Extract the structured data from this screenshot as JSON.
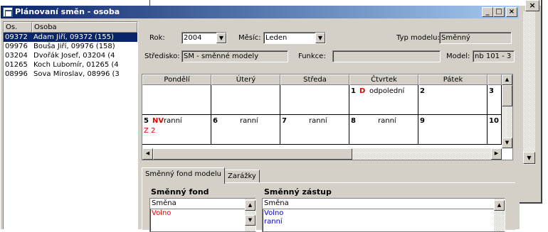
{
  "background": {
    "chars": [
      "ě",
      "í"
    ]
  },
  "window": {
    "title": "Plánovaní směn - osoba",
    "controls": {
      "minimize": "_",
      "maximize": "□",
      "close": "×"
    }
  },
  "employees": {
    "columns": [
      "Os. číslo",
      "Osoba"
    ],
    "rows": [
      {
        "id": "09372",
        "name": "Adam Jiří, 09372 (155)",
        "selected": true
      },
      {
        "id": "09976",
        "name": "Bouša Jiří, 09976 (158)",
        "selected": false
      },
      {
        "id": "03204",
        "name": "Dvořák Josef, 03204 (4",
        "selected": false
      },
      {
        "id": "01265",
        "name": "Koch Lubomír, 01265 (4",
        "selected": false
      },
      {
        "id": "08996",
        "name": "Sova Miroslav, 08996 (3",
        "selected": false
      }
    ]
  },
  "form": {
    "rok_label": "Rok:",
    "rok_value": "2004",
    "mesic_label": "Měsíc:",
    "mesic_value": "Leden",
    "typ_label": "Typ modelu:",
    "typ_value": "Směnný",
    "stredisko_label": "Středisko:",
    "stredisko_value": "SM - směnné modely",
    "funkce_label": "Funkce:",
    "funkce_value": "",
    "model_label": "Model:",
    "model_value": "nb 101 - 3"
  },
  "calendar": {
    "days": [
      "Pondělí",
      "Úterý",
      "Středa",
      "Čtvrtek",
      "Pátek"
    ],
    "week1": [
      {
        "day": "",
        "code": "",
        "shift": ""
      },
      {
        "day": "",
        "code": "",
        "shift": ""
      },
      {
        "day": "",
        "code": "",
        "shift": ""
      },
      {
        "day": "1",
        "code": "D",
        "shift": "odpolední"
      },
      {
        "day": "2",
        "code": "",
        "shift": ""
      },
      {
        "day": "3",
        "code": "",
        "shift": ""
      }
    ],
    "week2": [
      {
        "day": "5",
        "code": "NV",
        "shift": "ranní",
        "code2": "Z  2"
      },
      {
        "day": "6",
        "code": "",
        "shift": "ranní"
      },
      {
        "day": "7",
        "code": "",
        "shift": "ranní"
      },
      {
        "day": "8",
        "code": "",
        "shift": "ranní"
      },
      {
        "day": "9",
        "code": "",
        "shift": ""
      },
      {
        "day": "10",
        "code": "",
        "shift": ""
      }
    ]
  },
  "tabs": [
    {
      "label": "Směnný fond modelu",
      "active": true
    },
    {
      "label": "Zarážky",
      "active": false
    }
  ],
  "fond": {
    "title": "Směnný fond",
    "header": "Směna",
    "rows": [
      "Volno"
    ]
  },
  "zastup": {
    "title": "Směnný zástup",
    "header": "Směna",
    "rows": [
      "Volno",
      "ranní"
    ]
  },
  "colors": {
    "title_start": "#0a246a",
    "title_end": "#a6caf0",
    "selection": "#0a246a",
    "red": "#e00000",
    "blue": "#0000cc"
  }
}
